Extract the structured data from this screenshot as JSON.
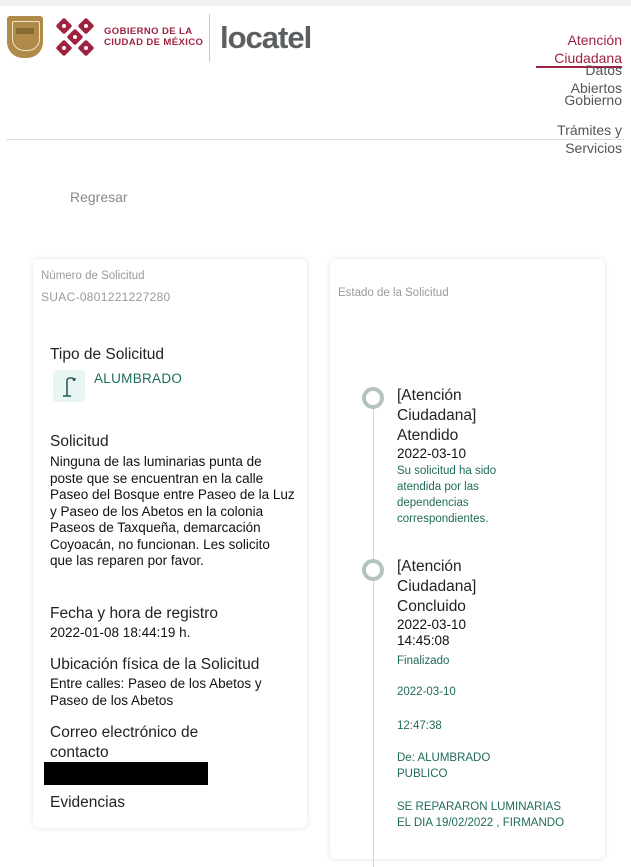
{
  "header": {
    "gov_line1": "GOBIERNO DE LA",
    "gov_line2": "CIUDAD DE MÉXICO",
    "brand": "locatel"
  },
  "nav": {
    "items": [
      {
        "label": "Atención Ciudadana",
        "active": true
      },
      {
        "label": "Datos Abiertos",
        "active": false
      },
      {
        "label": "Gobierno",
        "active": false
      },
      {
        "label": "Trámites y Servicios",
        "active": false
      }
    ]
  },
  "back_label": "Regresar",
  "request": {
    "number_label": "Número de Solicitud",
    "number": "SUAC-0801221227280",
    "type_label": "Tipo de Solicitud",
    "type_value": "ALUMBRADO",
    "type_icon": "street-lamp-icon",
    "request_label": "Solicitud",
    "request_text": "Ninguna de las luminarias punta de poste que se encuentran en la calle Paseo del Bosque entre Paseo de la Luz y Paseo de los Abetos en la colonia Paseos de Taxqueña, demarcación Coyoacán, no funcionan. Les solicito que las reparen por favor.",
    "date_label": "Fecha y hora de registro",
    "date_value": "2022-01-08 18:44:19 h.",
    "location_label": "Ubicación física de la Solicitud",
    "location_value": "Entre calles: Paseo de los Abetos y Paseo de los Abetos",
    "email_label": "Correo electrónico de contacto",
    "evidence_label": "Evidencias"
  },
  "status": {
    "label": "Estado de la Solicitud",
    "events": [
      {
        "title": "[Atención Ciudadana] Atendido",
        "date": "2022-03-10",
        "note": "Su solicitud ha sido atendida por las dependencias correspondientes."
      },
      {
        "title": "[Atención Ciudadana] Concluido",
        "date": "2022-03-10 14:45:08",
        "note": "Finalizado",
        "detail_date": "2022-03-10",
        "detail_time": "12:47:38",
        "from": "De: ALUMBRADO PUBLICO",
        "message": "SE REPARARON LUMINARIAS EL DIA 19/02/2022 , FIRMANDO"
      }
    ]
  },
  "colors": {
    "brand": "#9f2241",
    "accent_green": "#1f6b5a",
    "logo_gray": "#5c5f61"
  }
}
